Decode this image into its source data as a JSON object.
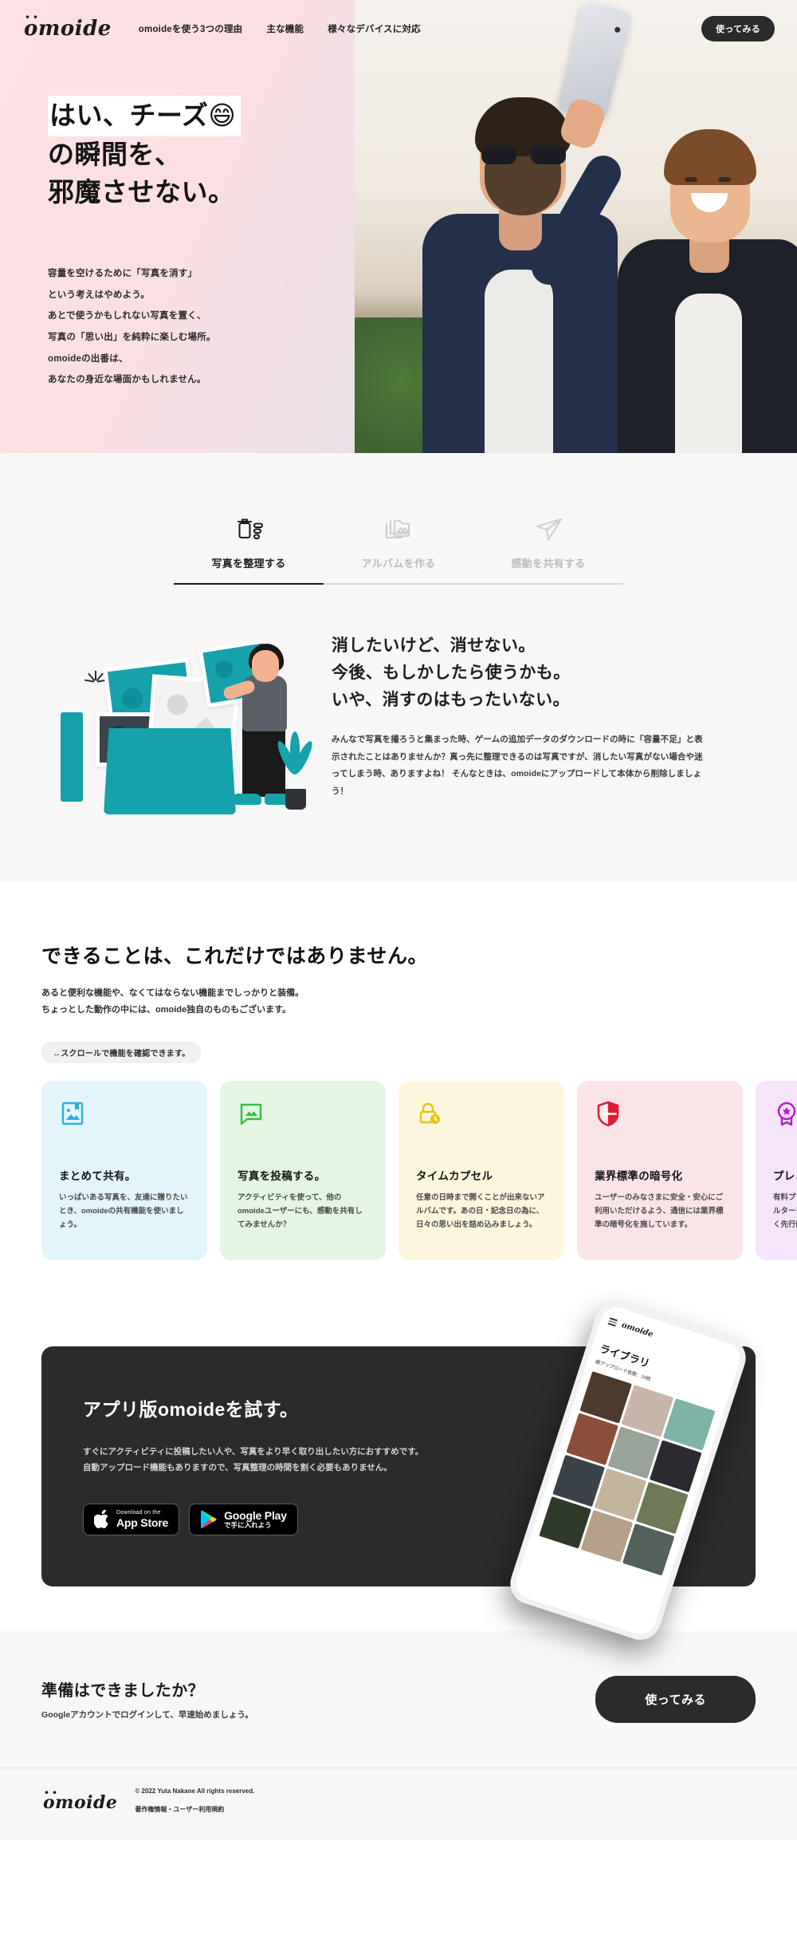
{
  "header": {
    "brand": "omoide",
    "nav": [
      {
        "label": "omoideを使う3つの理由"
      },
      {
        "label": "主な機能"
      },
      {
        "label": "様々なデバイスに対応"
      }
    ],
    "cta_label": "使ってみる"
  },
  "hero": {
    "title_line1": "はい、チーズ😄",
    "title_line2": "の瞬間を、",
    "title_line3": "邪魔させない。",
    "sub_line1": "容量を空けるために「写真を消す」",
    "sub_line2": "という考えはやめよう。",
    "sub_line3": "あとで使うかもしれない写真を置く、",
    "sub_line4": "写真の「思い出」を純粋に楽しむ場所。",
    "sub_line5": "omoideの出番は、",
    "sub_line6": "あなたの身近な場面かもしれません。"
  },
  "tabs": [
    {
      "label": "写真を整理する",
      "icon": "trash-icon",
      "active": true
    },
    {
      "label": "アルバムを作る",
      "icon": "folder-image-icon",
      "active": false
    },
    {
      "label": "感動を共有する",
      "icon": "paper-plane-icon",
      "active": false
    }
  ],
  "feature_block": {
    "heading_line1": "消したいけど、消せない。",
    "heading_line2": "今後、もしかしたら使うかも。",
    "heading_line3": "いや、消すのはもったいない。",
    "body": "みんなで写真を撮ろうと集まった時、ゲームの追加データのダウンロードの時に「容量不足」と表示されたことはありませんか？真っ先に整理できるのは写真ですが、消したい写真がない場合や迷ってしまう時、ありますよね！\nそんなときは、omoideにアップロードして本体から削除しましょう！"
  },
  "features": {
    "heading": "できることは、これだけではありません。",
    "lead_line1": "あると便利な機能や、なくてはならない機能までしっかりと装備。",
    "lead_line2": "ちょっとした動作の中には、omoide独自のものもございます。",
    "scroll_hint": "↔スクロールで機能を確認できます。",
    "cards": [
      {
        "title": "まとめて共有。",
        "body": "いっぱいある写真を、友達に贈りたいとき、omoideの共有機能を使いましょう。",
        "icon": "bookmark-image-icon",
        "bg": "#e3f4fb",
        "accent": "#2aaee0"
      },
      {
        "title": "写真を投稿する。",
        "body": "アクティビティを使って、他のomoideユーザーにも、感動を共有してみませんか？",
        "icon": "comment-image-icon",
        "bg": "#e4f5e3",
        "accent": "#34c13f"
      },
      {
        "title": "タイムカプセル",
        "body": "任意の日時まで開くことが出来ないアルバムです。あの日・記念日の為に、日々の思い出を詰め込みましょう。",
        "icon": "lock-clock-icon",
        "bg": "#fcf6dd",
        "accent": "#e0c81a"
      },
      {
        "title": "業界標準の暗号化",
        "body": "ユーザーのみなさまに安全・安心にご利用いただけるよう、通信には業界標準の暗号化を施しています。",
        "icon": "shield-icon",
        "bg": "#fbe4e8",
        "accent": "#e01b32"
      },
      {
        "title": "プレミアム",
        "body": "有料プランに加入すると、写真にフィルターをかけたり、最新機能をいち早く先行的に試せます。",
        "icon": "award-star-icon",
        "bg": "#f6e4fa",
        "accent": "#b41ad2"
      }
    ]
  },
  "app_cta": {
    "heading": "アプリ版omoideを試す。",
    "body_line1": "すぐにアクティビティに投稿したい人や、写真をより早く取り出したい方におすすめです。",
    "body_line2": "自動アップロード機能もありますので、写真整理の時間を割く必要もありません。",
    "appstore": {
      "small": "Download on the",
      "big": "App Store",
      "icon": "apple-icon"
    },
    "googleplay": {
      "big": "Google Play",
      "small": "で手に入れよう",
      "icon": "google-play-icon"
    },
    "phone": {
      "brand": "omoide",
      "title": "ライブラリ",
      "subtitle": "総アップロード枚数：10枚",
      "thumb_colors": [
        "#4c3a2c",
        "#c9b6ab",
        "#7fb3a6",
        "#8a4f3a",
        "#9aa39a",
        "#2a2a30",
        "#3c4348",
        "#c3b49c",
        "#6d7a55",
        "#2f3a2a",
        "#b5a089",
        "#54605a"
      ]
    }
  },
  "ready": {
    "heading": "準備はできましたか？",
    "sub": "Googleアカウントでログインして、早速始めましょう。",
    "button": "使ってみる"
  },
  "footer": {
    "brand": "omoide",
    "copyright": "© 2022 Yuta Nakane All rights reserved.",
    "links": "著作権情報・ユーザー利用規約"
  }
}
